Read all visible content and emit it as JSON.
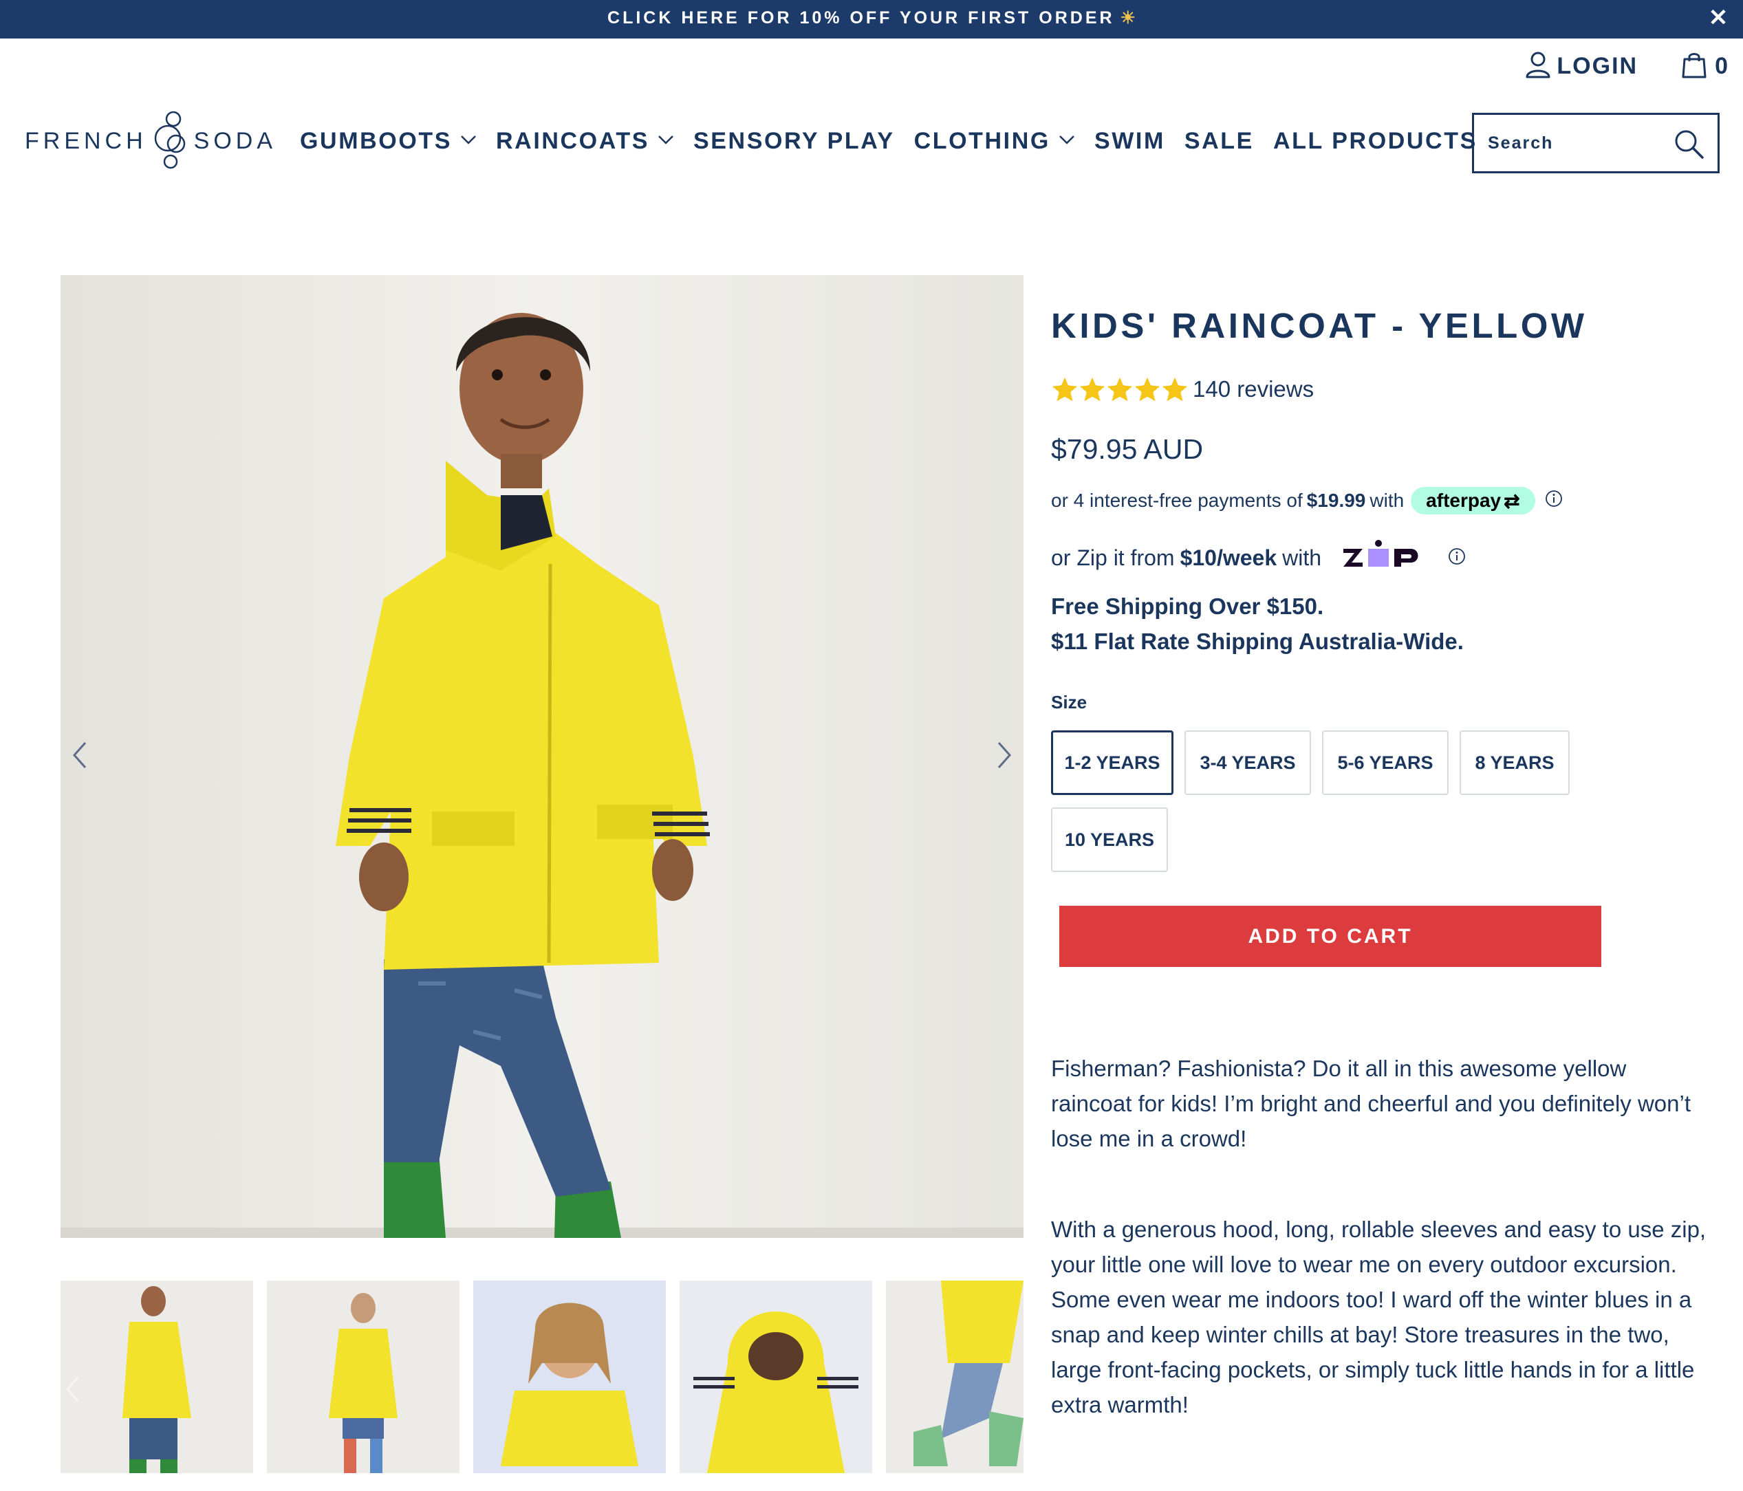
{
  "announcement": {
    "text": "CLICK HERE FOR 10% OFF YOUR FIRST ORDER",
    "sun_icon": "☀",
    "close_icon": "✕"
  },
  "header": {
    "logo_left": "FRENCH",
    "logo_right": "SODA",
    "login_label": "LOGIN",
    "cart_count": "0",
    "search_placeholder": "Search"
  },
  "nav": {
    "items": [
      {
        "label": "GUMBOOTS",
        "has_dropdown": true
      },
      {
        "label": "RAINCOATS",
        "has_dropdown": true
      },
      {
        "label": "SENSORY PLAY",
        "has_dropdown": false
      },
      {
        "label": "CLOTHING",
        "has_dropdown": true
      },
      {
        "label": "SWIM",
        "has_dropdown": false
      },
      {
        "label": "SALE",
        "has_dropdown": false
      },
      {
        "label": "ALL PRODUCTS",
        "has_dropdown": false
      }
    ]
  },
  "product": {
    "title": "KIDS' RAINCOAT - YELLOW",
    "rating": 5,
    "reviews": "140 reviews",
    "price": "$79.95 AUD",
    "afterpay": {
      "prefix": "or 4 interest-free payments of",
      "amount": "$19.99",
      "suffix": "with",
      "badge": "afterpay"
    },
    "zip": {
      "prefix": "or Zip it from",
      "amount": "$10/week",
      "suffix": "with",
      "logo": "zip"
    },
    "shipping": [
      "Free Shipping Over $150.",
      "$11 Flat Rate Shipping Australia-Wide."
    ],
    "size_label": "Size",
    "sizes": [
      "1-2 YEARS",
      "3-4 YEARS",
      "5-6 YEARS",
      "8 YEARS",
      "10 YEARS"
    ],
    "selected_size": "1-2 YEARS",
    "add_to_cart": "ADD TO CART",
    "description": [
      "Fisherman? Fashionista? Do it all in this awesome yellow raincoat for kids! I’m bright and cheerful and you definitely won’t lose me in a crowd!",
      "With a generous hood, long, rollable sleeves and easy to use zip, your little one will love to wear me on every outdoor excursion. Some even wear me indoors too! I ward off the winter blues in a snap and keep winter chills at bay! Store treasures in the two, large front-facing pockets, or simply tuck little hands in for a little extra warmth!"
    ]
  },
  "gallery": {
    "thumbnail_count": 5
  },
  "colors": {
    "navy": "#1b365d",
    "announce_bg": "#1d3b6a",
    "cart_red": "#dc3c3e",
    "afterpay_mint": "#b2fce4",
    "star_gold": "#f5c518",
    "coat_yellow": "#f2e22c"
  },
  "icons": {
    "login": "user-icon",
    "cart": "shopping-bag-icon",
    "search": "search-icon",
    "nav_dropdown": "chevron-down-icon",
    "gallery_prev": "chevron-left-icon",
    "gallery_next": "chevron-right-icon",
    "info": "info-icon"
  }
}
